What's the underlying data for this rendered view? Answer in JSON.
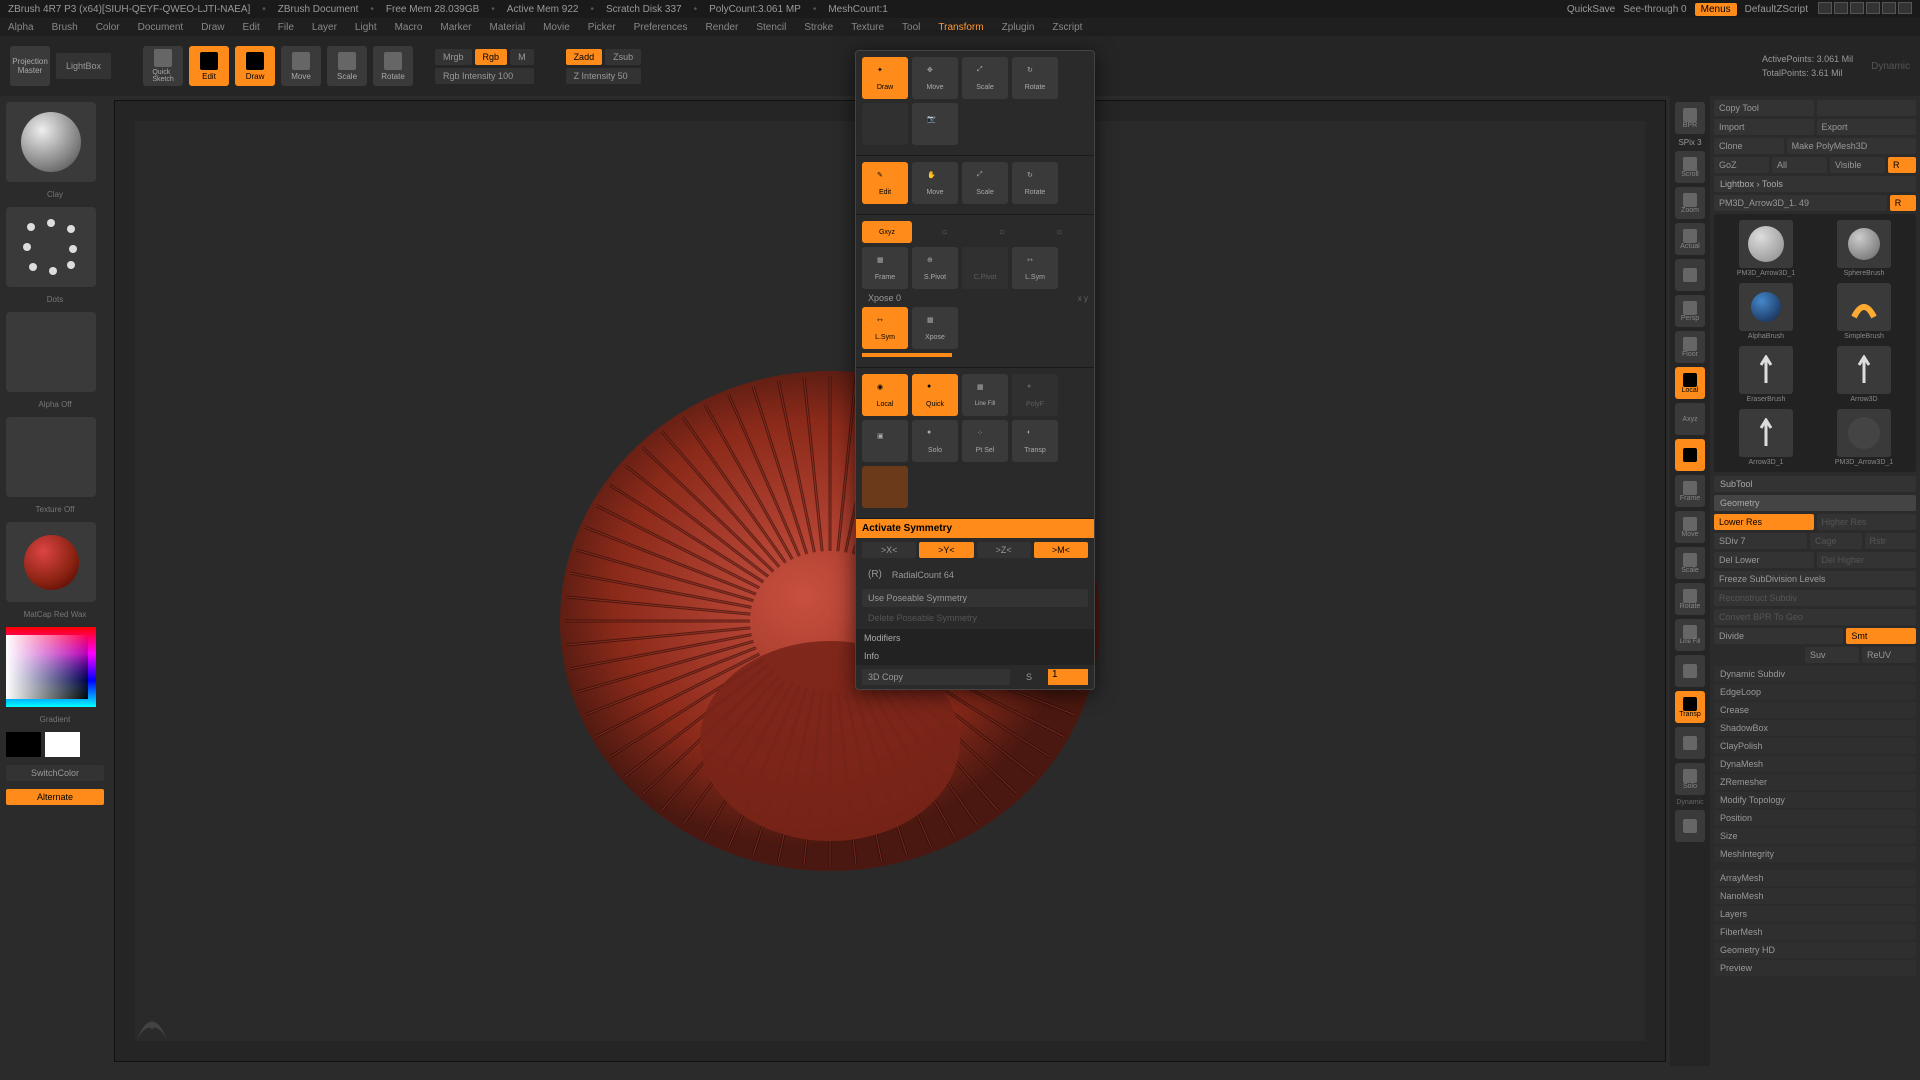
{
  "titlebar": {
    "app": "ZBrush 4R7 P3 (x64)[SIUH-QEYF-QWEO-LJTI-NAEA]",
    "doc": "ZBrush Document",
    "freemem": "Free Mem 28.039GB",
    "activemem": "Active Mem 922",
    "scratch": "Scratch Disk 337",
    "polycount": "PolyCount:3.061 MP",
    "meshcount": "MeshCount:1",
    "quicksave": "QuickSave",
    "seethrough": "See-through   0",
    "menus": "Menus",
    "config": "DefaultZScript"
  },
  "menubar": [
    "Alpha",
    "Brush",
    "Color",
    "Document",
    "Draw",
    "Edit",
    "File",
    "Layer",
    "Light",
    "Macro",
    "Marker",
    "Material",
    "Movie",
    "Picker",
    "Preferences",
    "Render",
    "Stencil",
    "Stroke",
    "Texture",
    "Tool",
    "Transform",
    "Zplugin",
    "Zscript"
  ],
  "toolbar": {
    "projection": "Projection\nMaster",
    "lightbox": "LightBox",
    "quicksketch": "Quick\nSketch",
    "edit": "Edit",
    "draw": "Draw",
    "move": "Move",
    "scale": "Scale",
    "rotate": "Rotate",
    "mrgb": "Mrgb",
    "rgb": "Rgb",
    "m": "M",
    "rgb_intensity": "Rgb Intensity 100",
    "zadd": "Zadd",
    "zsub": "Zsub",
    "z_intensity": "Z Intensity 50",
    "dynamic": "Dynamic",
    "activepoints": "ActivePoints: 3.061 Mil",
    "totalpoints": "TotalPoints: 3.61 Mil"
  },
  "left": {
    "clay": "Clay",
    "dots": "Dots",
    "alpha_off": "Alpha Off",
    "texture_off": "Texture Off",
    "matcap": "MatCap Red Wax",
    "gradient": "Gradient",
    "switchcolor": "SwitchColor",
    "alternate": "Alternate"
  },
  "floating": {
    "draw": "Draw",
    "move": "Move",
    "scale": "Scale",
    "rotate": "Rotate",
    "edit": "Edit",
    "gxyz": "Gxyz",
    "frame": "Frame",
    "spivot": "S.Pivot",
    "cpivot": "C.Pivot",
    "lsym": "L.Sym",
    "xpose": "Xpose 0",
    "lsym2": "L.Sym",
    "xpose2": "Xpose",
    "local": "Local",
    "quick": "Quick",
    "linefill": "Line Fill",
    "polyf": "PolyF",
    "ghost": "",
    "solo": "Solo",
    "ptsel": "Pt Sel",
    "transp": "Transp",
    "activate_symmetry": "Activate Symmetry",
    "ax_x": ">X<",
    "ax_y": ">Y<",
    "ax_z": ">Z<",
    "ax_m": ">M<",
    "r": "(R)",
    "radialcount": "RadialCount 64",
    "use_poseable": "Use Poseable Symmetry",
    "delete_poseable": "Delete Poseable Symmetry",
    "modifiers": "Modifiers",
    "info": "Info",
    "copy3d": "3D Copy",
    "copy_s": "S",
    "copy_val": "1"
  },
  "rightstrip": [
    "BPR",
    "SPix 3",
    "Scroll",
    "Zoom",
    "Actual",
    "",
    "Persp",
    "Floor",
    "Local",
    "Axyz",
    "",
    "Frame",
    "Move",
    "Scale",
    "Rotate",
    "Line Fill",
    "",
    "Transp",
    "",
    "Solo",
    "Dynamic",
    ""
  ],
  "right": {
    "copytool": "Copy Tool",
    "pastetool": "",
    "import": "Import",
    "export": "Export",
    "clone": "Clone",
    "makepoly": "Make PolyMesh3D",
    "goz": "GoZ",
    "all": "All",
    "visible": "Visible",
    "r": "R",
    "lightbox_tools": "Lightbox › Tools",
    "active_tool": "PM3D_Arrow3D_1. 49",
    "tools": [
      {
        "name": "PM3D_Arrow3D_1"
      },
      {
        "name": "SphereBrush"
      },
      {
        "name": "AlphaBrush"
      },
      {
        "name": "SimpleBrush"
      },
      {
        "name": "EraserBrush"
      },
      {
        "name": "Arrow3D"
      },
      {
        "name": "Arrow3D_1"
      },
      {
        "name": "PM3D_Arrow3D_1"
      }
    ],
    "subtool": "SubTool",
    "geometry": "Geometry",
    "lower_res": "Lower Res",
    "higher_res": "Higher Res",
    "sdiv": "SDiv 7",
    "del_lower": "Del Lower",
    "del_higher": "Del Higher",
    "freeze": "Freeze SubDivision Levels",
    "reconstruct": "Reconstruct Subdiv",
    "convert": "Convert BPR To Geo",
    "divide": "Divide",
    "smt": "Smt",
    "suv": "Suv",
    "reuv": "ReUV",
    "sections": [
      "Dynamic Subdiv",
      "EdgeLoop",
      "Crease",
      "ShadowBox",
      "ClayPolish",
      "DynaMesh",
      "ZRemesher",
      "Modify Topology",
      "Position",
      "Size",
      "MeshIntegrity",
      "ArrayMesh",
      "NanoMesh",
      "Layers",
      "FiberMesh",
      "Geometry HD",
      "Preview"
    ]
  }
}
